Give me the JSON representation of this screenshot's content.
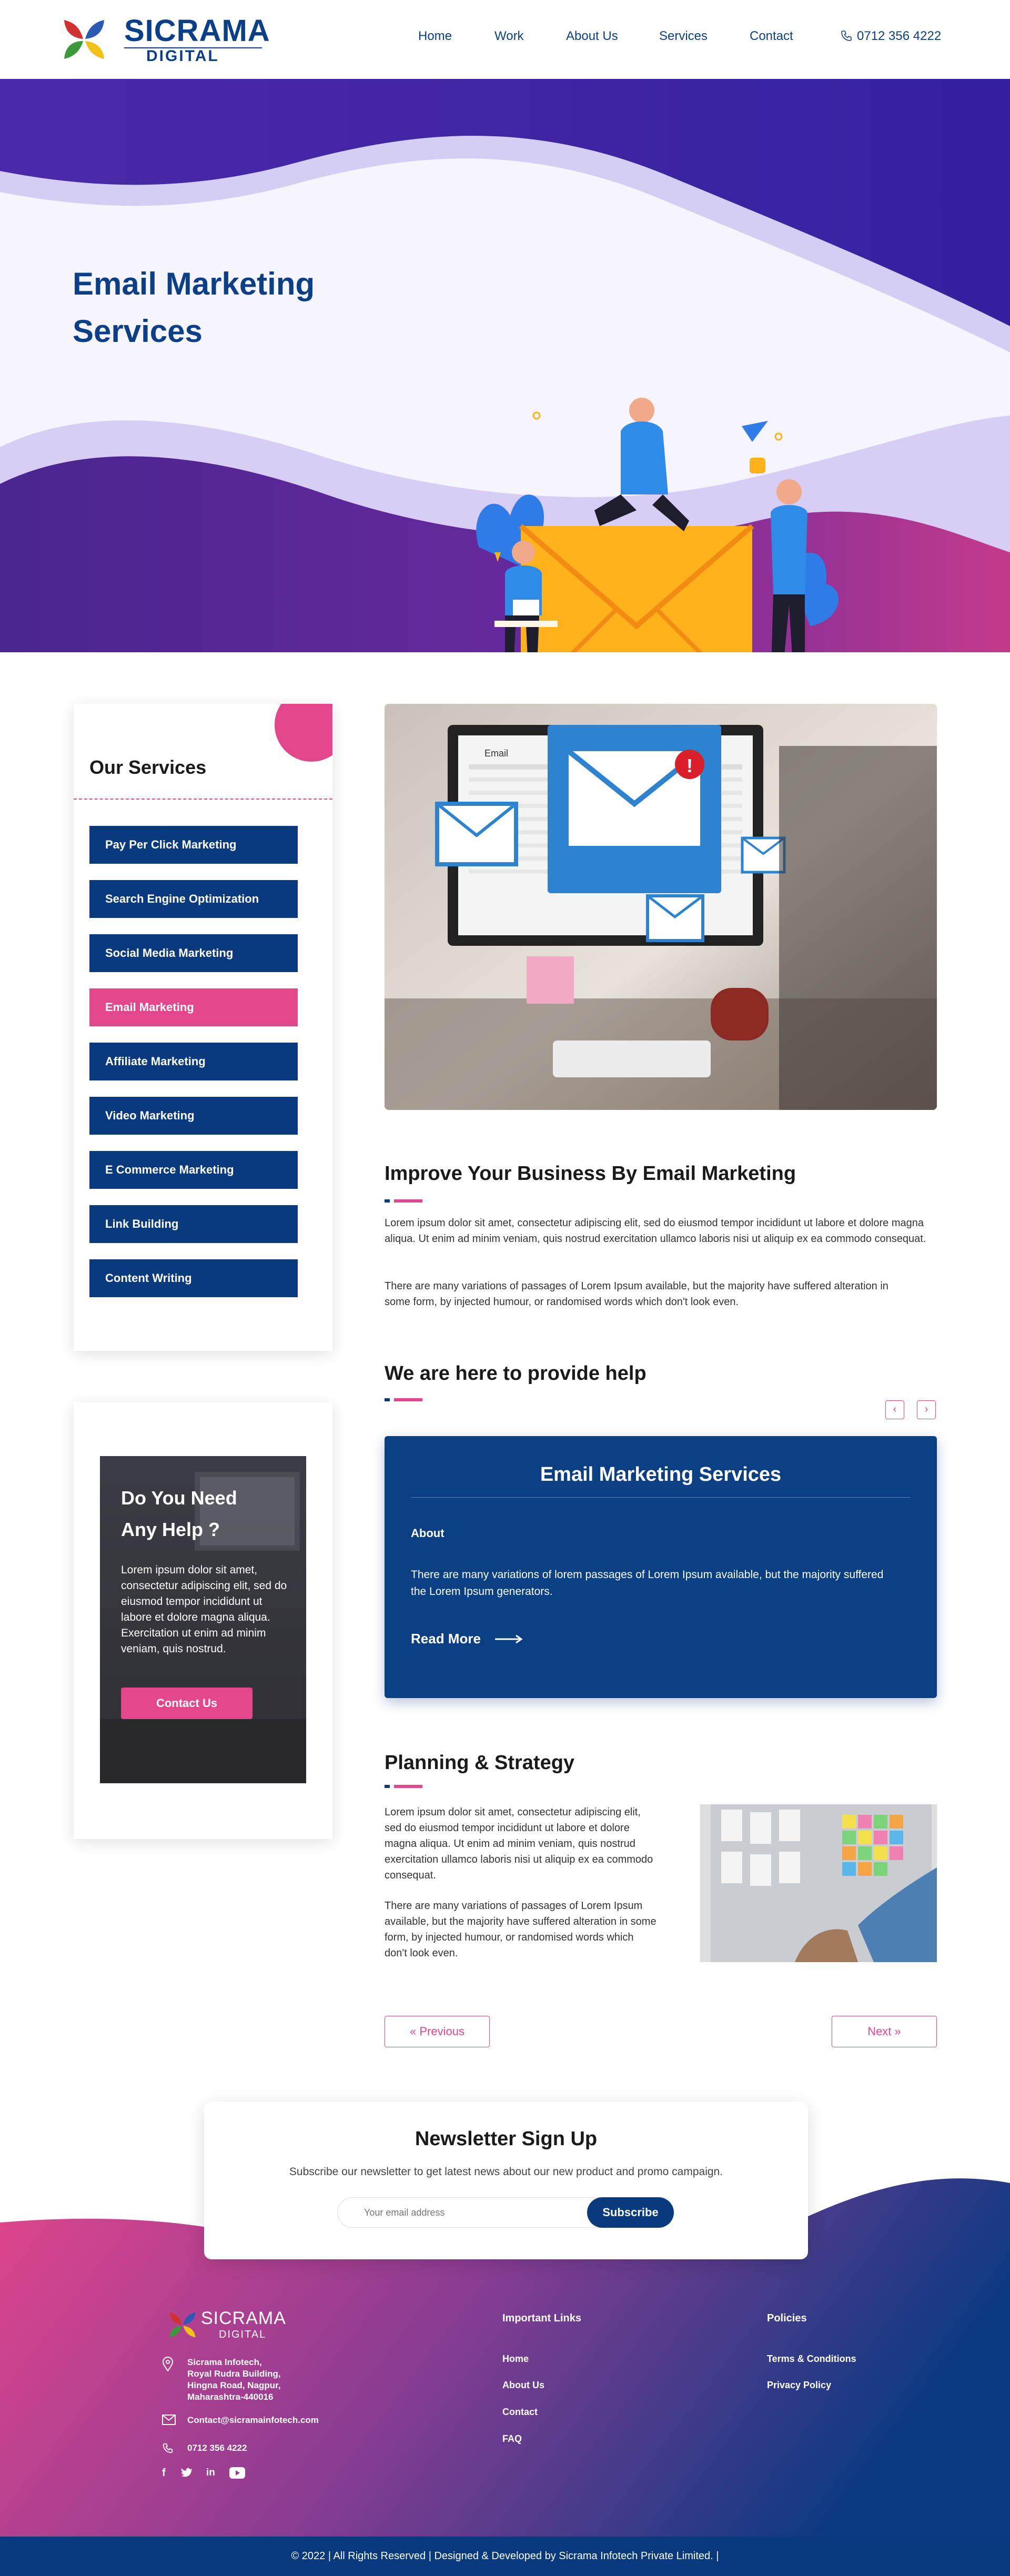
{
  "header": {
    "logo_word": "SICRAMA",
    "logo_sub": "DIGITAL",
    "nav": [
      "Home",
      "Work",
      "About Us",
      "Services",
      "Contact"
    ],
    "phone": "0712 356 4222"
  },
  "hero": {
    "title_line1": "Email Marketing",
    "title_line2": "Services"
  },
  "sidebar": {
    "title": "Our Services",
    "items": [
      "Pay Per Click Marketing",
      "Search Engine Optimization",
      "Social Media Marketing",
      "Email Marketing",
      "Affiliate Marketing",
      "Video Marketing",
      "E Commerce Marketing",
      "Link Building",
      "Content Writing"
    ],
    "active_index": 3
  },
  "help": {
    "title_line1": "Do You Need",
    "title_line2": "Any Help ?",
    "text": "Lorem ipsum dolor sit amet, consectetur adipiscing elit, sed do eiusmod tempor incididunt ut labore et dolore magna aliqua. Exercitation ut enim ad minim veniam, quis nostrud.",
    "button": "Contact Us"
  },
  "main": {
    "photo_label": "Email",
    "improve_title": "Improve Your Business By Email Marketing",
    "improve_p1": "Lorem ipsum dolor sit amet, consectetur adipiscing elit, sed do eiusmod tempor incididunt ut labore et dolore magna aliqua. Ut enim ad minim veniam, quis nostrud exercitation ullamco laboris nisi ut aliquip ex ea commodo consequat.",
    "improve_p2": "There are many variations of passages of Lorem Ipsum available, but the majority have suffered alteration in some form, by injected humour, or randomised words which don't look even.",
    "help_title": "We are here to provide help",
    "slide": {
      "title": "Email Marketing Services",
      "label": "About",
      "text": "There are many variations of lorem passages of Lorem Ipsum available, but the majority suffered the Lorem Ipsum generators.",
      "more": "Read More"
    },
    "plan_title": "Planning & Strategy",
    "plan_p1": "Lorem ipsum dolor sit amet, consectetur adipiscing elit, sed do eiusmod tempor incididunt ut labore et dolore magna aliqua. Ut enim ad minim veniam, quis nostrud exercitation ullamco laboris nisi ut aliquip ex ea commodo consequat.",
    "plan_p2": "There are many variations of passages of Lorem Ipsum available, but the majority have suffered alteration in some form, by injected humour, or randomised words which don't look even.",
    "prev": "Previous",
    "next": "Next"
  },
  "newsletter": {
    "title": "Newsletter Sign Up",
    "subtitle": "Subscribe our newsletter to get latest news about our new product and promo campaign.",
    "placeholder": "Your email address",
    "button": "Subscribe"
  },
  "footer": {
    "logo_word": "SICRAMA",
    "logo_sub": "DIGITAL",
    "address": [
      "Sicrama Infotech,",
      "Royal Rudra Building,",
      "Hingna Road, Nagpur,",
      "Maharashtra-440016"
    ],
    "email": "Contact@sicramainfotech.com",
    "phone": "0712 356 4222",
    "social": [
      "f",
      "t",
      "in",
      "yt"
    ],
    "important_title": "Important Links",
    "important_links": [
      "Home",
      "About Us",
      "Contact",
      "FAQ"
    ],
    "policies_title": "Policies",
    "policies_links": [
      "Terms & Conditions",
      "Privacy Policy"
    ],
    "copyright": "© 2022 | All Rights Reserved | Designed & Developed by Sicrama Infotech Private Limited. |"
  },
  "colors": {
    "brand_blue": "#0a3a7e",
    "accent_pink": "#e4468c",
    "hero_purple": "#3d1fa3"
  }
}
